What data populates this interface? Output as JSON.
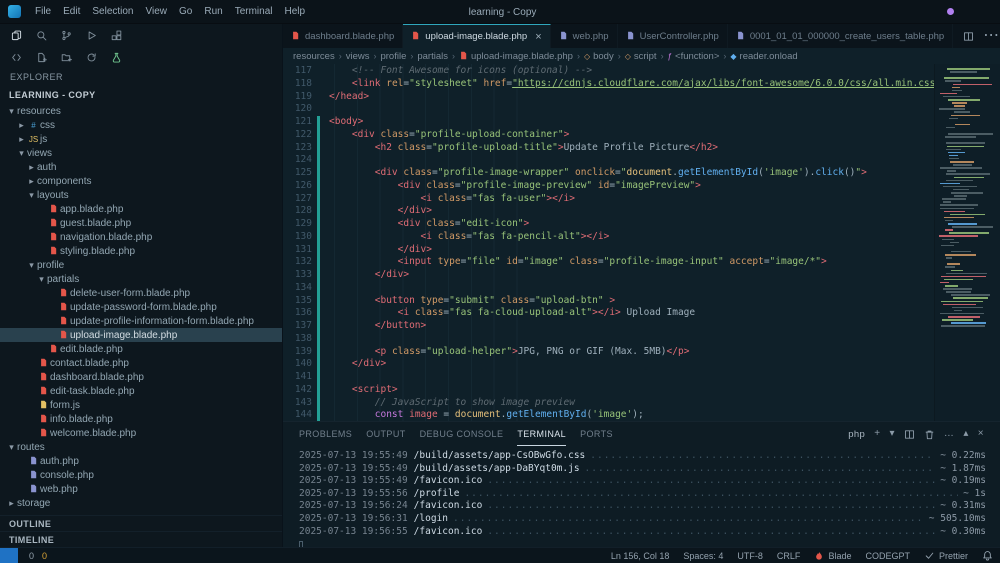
{
  "titlebar": {
    "menus": [
      "File",
      "Edit",
      "Selection",
      "View",
      "Go",
      "Run",
      "Terminal",
      "Help"
    ],
    "title": "learning - Copy"
  },
  "activity_bar": {
    "row1": [
      "files-icon",
      "search-icon",
      "source-control-icon",
      "run-debug-icon",
      "extensions-icon"
    ],
    "row2": [
      "remote-icon",
      "new-file-icon",
      "new-folder-icon",
      "refresh-icon",
      "testing-icon"
    ]
  },
  "explorer": {
    "title": "EXPLORER",
    "section": "LEARNING - COPY",
    "bottom_sections": [
      "OUTLINE",
      "TIMELINE"
    ],
    "tree": [
      {
        "label": "resources",
        "indent": 0,
        "type": "folder",
        "state": "open"
      },
      {
        "label": "css",
        "indent": 1,
        "type": "folder",
        "state": "closed",
        "icon": "css"
      },
      {
        "label": "js",
        "indent": 1,
        "type": "folder",
        "state": "closed",
        "icon": "jsf"
      },
      {
        "label": "views",
        "indent": 1,
        "type": "folder",
        "state": "open"
      },
      {
        "label": "auth",
        "indent": 2,
        "type": "folder",
        "state": "closed"
      },
      {
        "label": "components",
        "indent": 2,
        "type": "folder",
        "state": "closed"
      },
      {
        "label": "layouts",
        "indent": 2,
        "type": "folder",
        "state": "open"
      },
      {
        "label": "app.blade.php",
        "indent": 3,
        "type": "file",
        "icon": "blade"
      },
      {
        "label": "guest.blade.php",
        "indent": 3,
        "type": "file",
        "icon": "blade"
      },
      {
        "label": "navigation.blade.php",
        "indent": 3,
        "type": "file",
        "icon": "blade"
      },
      {
        "label": "styling.blade.php",
        "indent": 3,
        "type": "file",
        "icon": "blade"
      },
      {
        "label": "profile",
        "indent": 2,
        "type": "folder",
        "state": "open"
      },
      {
        "label": "partials",
        "indent": 3,
        "type": "folder",
        "state": "open"
      },
      {
        "label": "delete-user-form.blade.php",
        "indent": 4,
        "type": "file",
        "icon": "blade"
      },
      {
        "label": "update-password-form.blade.php",
        "indent": 4,
        "type": "file",
        "icon": "blade"
      },
      {
        "label": "update-profile-information-form.blade.php",
        "indent": 4,
        "type": "file",
        "icon": "blade"
      },
      {
        "label": "upload-image.blade.php",
        "indent": 4,
        "type": "file",
        "icon": "blade",
        "selected": true
      },
      {
        "label": "edit.blade.php",
        "indent": 3,
        "type": "file",
        "icon": "blade"
      },
      {
        "label": "contact.blade.php",
        "indent": 2,
        "type": "file",
        "icon": "blade"
      },
      {
        "label": "dashboard.blade.php",
        "indent": 2,
        "type": "file",
        "icon": "blade"
      },
      {
        "label": "edit-task.blade.php",
        "indent": 2,
        "type": "file",
        "icon": "blade"
      },
      {
        "label": "form.js",
        "indent": 2,
        "type": "file",
        "icon": "js"
      },
      {
        "label": "info.blade.php",
        "indent": 2,
        "type": "file",
        "icon": "blade"
      },
      {
        "label": "welcome.blade.php",
        "indent": 2,
        "type": "file",
        "icon": "blade"
      },
      {
        "label": "routes",
        "indent": 0,
        "type": "folder",
        "state": "open"
      },
      {
        "label": "auth.php",
        "indent": 1,
        "type": "file",
        "icon": "php"
      },
      {
        "label": "console.php",
        "indent": 1,
        "type": "file",
        "icon": "php"
      },
      {
        "label": "web.php",
        "indent": 1,
        "type": "file",
        "icon": "php"
      },
      {
        "label": "storage",
        "indent": 0,
        "type": "folder",
        "state": "closed"
      }
    ]
  },
  "tabs": [
    {
      "label": "dashboard.blade.php",
      "icon": "blade"
    },
    {
      "label": "upload-image.blade.php",
      "icon": "blade",
      "active": true
    },
    {
      "label": "web.php",
      "icon": "php"
    },
    {
      "label": "UserController.php",
      "icon": "php"
    },
    {
      "label": "0001_01_01_000000_create_users_table.php",
      "icon": "php"
    }
  ],
  "tab_actions": [
    "split-icon",
    "more-icon"
  ],
  "breadcrumbs": [
    {
      "label": "resources"
    },
    {
      "label": "views"
    },
    {
      "label": "profile"
    },
    {
      "label": "partials"
    },
    {
      "label": "upload-image.blade.php",
      "icon": "blade"
    },
    {
      "label": "body",
      "icon": "element"
    },
    {
      "label": "script",
      "icon": "element"
    },
    {
      "label": "<function>",
      "icon": "function"
    },
    {
      "label": "reader.onload",
      "icon": "property"
    }
  ],
  "editor": {
    "lines": [
      {
        "n": 117,
        "seg": [
          [
            "c",
            "    <!-- Font Awesome for icons (optional) -->"
          ]
        ]
      },
      {
        "n": 118,
        "seg": [
          [
            "p",
            "    "
          ],
          [
            "t",
            "<link"
          ],
          [
            "a",
            " rel"
          ],
          [
            "p",
            "="
          ],
          [
            "s",
            "\"stylesheet\""
          ],
          [
            "a",
            " href"
          ],
          [
            "p",
            "="
          ],
          [
            "su",
            "\"https://cdnjs.cloudflare.com/ajax/libs/font-awesome/6.0.0/css/all.min.css\""
          ],
          [
            "t",
            ">"
          ]
        ]
      },
      {
        "n": 119,
        "seg": [
          [
            "t",
            "</head>"
          ]
        ]
      },
      {
        "n": 120,
        "seg": []
      },
      {
        "n": 121,
        "seg": [
          [
            "t",
            "<body>"
          ]
        ]
      },
      {
        "n": 122,
        "seg": [
          [
            "p",
            "    "
          ],
          [
            "t",
            "<div"
          ],
          [
            "a",
            " class"
          ],
          [
            "p",
            "="
          ],
          [
            "s",
            "\"profile-upload-container\""
          ],
          [
            "t",
            ">"
          ]
        ]
      },
      {
        "n": 123,
        "seg": [
          [
            "p",
            "        "
          ],
          [
            "t",
            "<h2"
          ],
          [
            "a",
            " class"
          ],
          [
            "p",
            "="
          ],
          [
            "s",
            "\"profile-upload-title\""
          ],
          [
            "t",
            ">"
          ],
          [
            "p",
            "Update Profile Picture"
          ],
          [
            "t",
            "</h2>"
          ]
        ]
      },
      {
        "n": 124,
        "seg": []
      },
      {
        "n": 125,
        "seg": [
          [
            "p",
            "        "
          ],
          [
            "t",
            "<div"
          ],
          [
            "a",
            " class"
          ],
          [
            "p",
            "="
          ],
          [
            "s",
            "\"profile-image-wrapper\""
          ],
          [
            "a",
            " onclick"
          ],
          [
            "p",
            "="
          ],
          [
            "s",
            "\""
          ],
          [
            "o",
            "document"
          ],
          [
            "p",
            "."
          ],
          [
            "f",
            "getElementById"
          ],
          [
            "p",
            "("
          ],
          [
            "s",
            "'image'"
          ],
          [
            "p",
            ")."
          ],
          [
            "f",
            "click"
          ],
          [
            "p",
            "()"
          ],
          [
            "s",
            "\""
          ],
          [
            "t",
            ">"
          ]
        ]
      },
      {
        "n": 126,
        "seg": [
          [
            "p",
            "            "
          ],
          [
            "t",
            "<div"
          ],
          [
            "a",
            " class"
          ],
          [
            "p",
            "="
          ],
          [
            "s",
            "\"profile-image-preview\""
          ],
          [
            "a",
            " id"
          ],
          [
            "p",
            "="
          ],
          [
            "s",
            "\"imagePreview\""
          ],
          [
            "t",
            ">"
          ]
        ]
      },
      {
        "n": 127,
        "seg": [
          [
            "p",
            "                "
          ],
          [
            "t",
            "<i"
          ],
          [
            "a",
            " class"
          ],
          [
            "p",
            "="
          ],
          [
            "s",
            "\"fas fa-user\""
          ],
          [
            "t",
            "></i>"
          ]
        ]
      },
      {
        "n": 128,
        "seg": [
          [
            "p",
            "            "
          ],
          [
            "t",
            "</div>"
          ]
        ]
      },
      {
        "n": 129,
        "seg": [
          [
            "p",
            "            "
          ],
          [
            "t",
            "<div"
          ],
          [
            "a",
            " class"
          ],
          [
            "p",
            "="
          ],
          [
            "s",
            "\"edit-icon\""
          ],
          [
            "t",
            ">"
          ]
        ]
      },
      {
        "n": 130,
        "seg": [
          [
            "p",
            "                "
          ],
          [
            "t",
            "<i"
          ],
          [
            "a",
            " class"
          ],
          [
            "p",
            "="
          ],
          [
            "s",
            "\"fas fa-pencil-alt\""
          ],
          [
            "t",
            "></i>"
          ]
        ]
      },
      {
        "n": 131,
        "seg": [
          [
            "p",
            "            "
          ],
          [
            "t",
            "</div>"
          ]
        ]
      },
      {
        "n": 132,
        "seg": [
          [
            "p",
            "            "
          ],
          [
            "t",
            "<input"
          ],
          [
            "a",
            " type"
          ],
          [
            "p",
            "="
          ],
          [
            "s",
            "\"file\""
          ],
          [
            "a",
            " id"
          ],
          [
            "p",
            "="
          ],
          [
            "s",
            "\"image\""
          ],
          [
            "a",
            " class"
          ],
          [
            "p",
            "="
          ],
          [
            "s",
            "\"profile-image-input\""
          ],
          [
            "a",
            " accept"
          ],
          [
            "p",
            "="
          ],
          [
            "s",
            "\"image/*\""
          ],
          [
            "t",
            ">"
          ]
        ]
      },
      {
        "n": 133,
        "seg": [
          [
            "p",
            "        "
          ],
          [
            "t",
            "</div>"
          ]
        ]
      },
      {
        "n": 134,
        "seg": []
      },
      {
        "n": 135,
        "seg": [
          [
            "p",
            "        "
          ],
          [
            "t",
            "<button"
          ],
          [
            "a",
            " type"
          ],
          [
            "p",
            "="
          ],
          [
            "s",
            "\"submit\""
          ],
          [
            "a",
            " class"
          ],
          [
            "p",
            "="
          ],
          [
            "s",
            "\"upload-btn\""
          ],
          [
            "p",
            " "
          ],
          [
            "t",
            ">"
          ]
        ]
      },
      {
        "n": 136,
        "seg": [
          [
            "p",
            "            "
          ],
          [
            "t",
            "<i"
          ],
          [
            "a",
            " class"
          ],
          [
            "p",
            "="
          ],
          [
            "s",
            "\"fas fa-cloud-upload-alt\""
          ],
          [
            "t",
            "></i>"
          ],
          [
            "p",
            " Upload Image"
          ]
        ]
      },
      {
        "n": 137,
        "seg": [
          [
            "p",
            "        "
          ],
          [
            "t",
            "</button>"
          ]
        ]
      },
      {
        "n": 138,
        "seg": []
      },
      {
        "n": 139,
        "seg": [
          [
            "p",
            "        "
          ],
          [
            "t",
            "<p"
          ],
          [
            "a",
            " class"
          ],
          [
            "p",
            "="
          ],
          [
            "s",
            "\"upload-helper\""
          ],
          [
            "t",
            ">"
          ],
          [
            "p",
            "JPG, PNG or GIF (Max. 5MB)"
          ],
          [
            "t",
            "</p>"
          ]
        ]
      },
      {
        "n": 140,
        "seg": [
          [
            "p",
            "    "
          ],
          [
            "t",
            "</div>"
          ]
        ]
      },
      {
        "n": 141,
        "seg": []
      },
      {
        "n": 142,
        "seg": [
          [
            "p",
            "    "
          ],
          [
            "t",
            "<script>"
          ]
        ]
      },
      {
        "n": 143,
        "seg": [
          [
            "c",
            "        // JavaScript to show image preview"
          ]
        ]
      },
      {
        "n": 144,
        "seg": [
          [
            "p",
            "        "
          ],
          [
            "k",
            "const"
          ],
          [
            "v",
            " image"
          ],
          [
            "p",
            " = "
          ],
          [
            "o",
            "document"
          ],
          [
            "p",
            "."
          ],
          [
            "f",
            "getElementById"
          ],
          [
            "p",
            "("
          ],
          [
            "s",
            "'image'"
          ],
          [
            "p",
            ");"
          ]
        ]
      }
    ]
  },
  "panel": {
    "tabs": [
      {
        "label": "PROBLEMS"
      },
      {
        "label": "OUTPUT"
      },
      {
        "label": "DEBUG CONSOLE"
      },
      {
        "label": "TERMINAL",
        "active": true
      },
      {
        "label": "PORTS"
      }
    ],
    "shell_label": "php",
    "actions": [
      "plus-icon",
      "chevron-down-icon",
      "split-icon",
      "trash-icon",
      "ellipsis-icon",
      "chevron-up-icon",
      "close-icon"
    ],
    "terminal_lines": [
      {
        "time": "2025-07-13 19:55:49",
        "path": "/build/assets/app-CsOBwGfo.css",
        "dur": "~ 0.22ms"
      },
      {
        "time": "2025-07-13 19:55:49",
        "path": "/build/assets/app-DaBYqt0m.js",
        "dur": "~ 1.87ms"
      },
      {
        "time": "2025-07-13 19:55:49",
        "path": "/favicon.ico",
        "dur": "~ 0.19ms"
      },
      {
        "time": "2025-07-13 19:55:56",
        "path": "/profile",
        "dur": "~ 1s"
      },
      {
        "time": "2025-07-13 19:56:24",
        "path": "/favicon.ico",
        "dur": "~ 0.31ms"
      },
      {
        "time": "2025-07-13 19:56:31",
        "path": "/login",
        "dur": "~ 505.10ms"
      },
      {
        "time": "2025-07-13 19:56:55",
        "path": "/favicon.ico",
        "dur": "~ 0.30ms"
      }
    ]
  },
  "statusbar": {
    "problems": {
      "errors": "0",
      "warnings": "0"
    },
    "right": [
      {
        "name": "cursor-position",
        "label": "Ln 156, Col 18"
      },
      {
        "name": "indentation",
        "label": "Spaces: 4"
      },
      {
        "name": "encoding",
        "label": "UTF-8"
      },
      {
        "name": "eol",
        "label": "CRLF"
      },
      {
        "name": "language-mode",
        "label": "Blade",
        "icon": "flame-icon"
      },
      {
        "name": "codegpt",
        "label": "CODEGPT"
      },
      {
        "name": "prettier",
        "label": "Prettier",
        "icon": "check-icon"
      },
      {
        "name": "notifications",
        "label": "",
        "icon": "bell-icon"
      }
    ]
  },
  "colors": {
    "accent_teal": "#2fa7bd",
    "blade_red": "#e4564a",
    "php_purple": "#8a93cf",
    "js_yellow": "#e2c064",
    "remote_blue": "#1f72c4",
    "copilot_purple": "#b180f0"
  }
}
